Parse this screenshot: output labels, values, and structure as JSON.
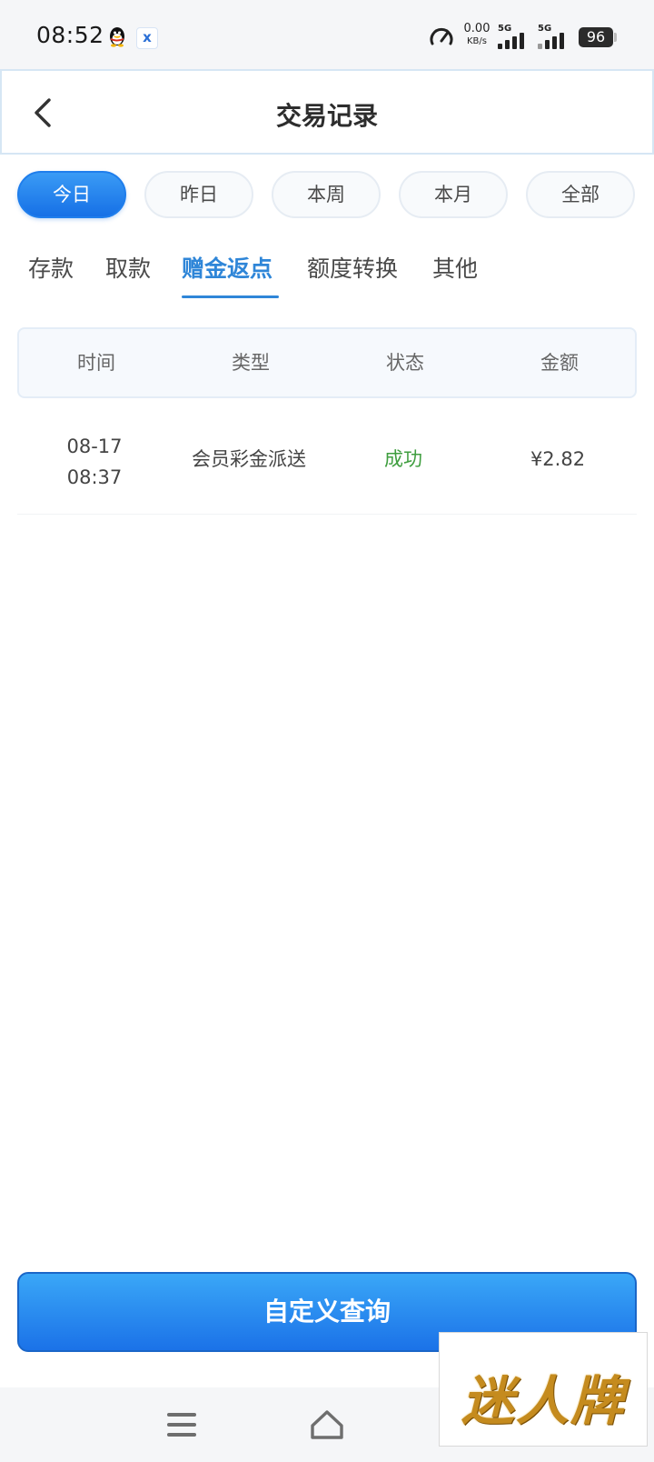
{
  "status_bar": {
    "time": "08:52",
    "app_badge": "x",
    "net_speed_value": "0.00",
    "net_speed_unit": "KB/s",
    "signal1_label": "5G",
    "signal2_label": "5G",
    "battery": "96"
  },
  "header": {
    "title": "交易记录"
  },
  "date_filters": [
    {
      "label": "今日",
      "active": true
    },
    {
      "label": "昨日",
      "active": false
    },
    {
      "label": "本周",
      "active": false
    },
    {
      "label": "本月",
      "active": false
    },
    {
      "label": "全部",
      "active": false
    }
  ],
  "categories": [
    {
      "label": "存款",
      "active": false
    },
    {
      "label": "取款",
      "active": false
    },
    {
      "label": "赠金返点",
      "active": true
    },
    {
      "label": "额度转换",
      "active": false
    },
    {
      "label": "其他",
      "active": false
    }
  ],
  "table": {
    "headers": [
      "时间",
      "类型",
      "状态",
      "金额"
    ],
    "rows": [
      {
        "date": "08-17",
        "time": "08:37",
        "type": "会员彩金派送",
        "status": "成功",
        "amount": "¥2.82"
      }
    ]
  },
  "query_button": "自定义查询",
  "watermark": "迷人牌",
  "colors": {
    "accent": "#2f86d8",
    "button_gradient_top": "#3aa7f7",
    "button_gradient_bottom": "#1b72e8",
    "success": "#3f9e3f"
  }
}
